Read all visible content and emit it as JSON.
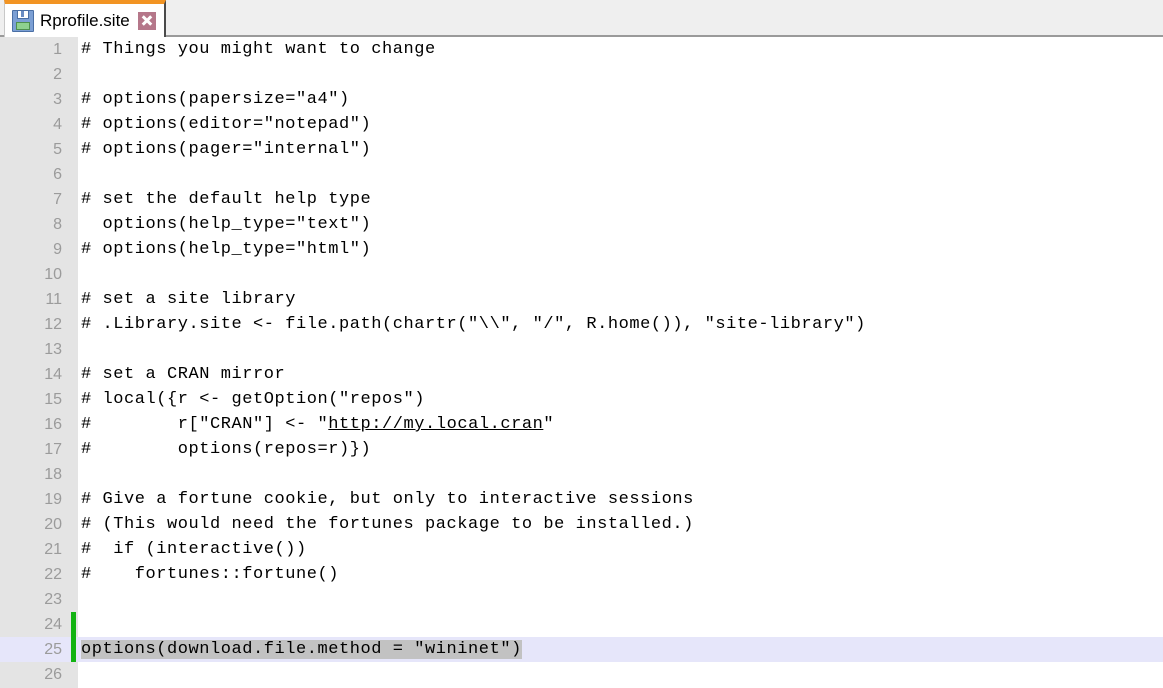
{
  "tab": {
    "title": "Rprofile.site",
    "save_icon": "floppy-disk-save-icon",
    "close_icon": "close-x-icon",
    "modified_accent_color": "#f29423"
  },
  "editor": {
    "gutter_color": "#e4e4e4",
    "line_number_color": "#9b9b9b",
    "current_line_color": "#e6e6fa",
    "selection_color": "#c2c2c2",
    "change_marker_color": "#12b312",
    "lines": [
      {
        "n": "1",
        "text": "# Things you might want to change"
      },
      {
        "n": "2",
        "text": ""
      },
      {
        "n": "3",
        "text": "# options(papersize=\"a4\")"
      },
      {
        "n": "4",
        "text": "# options(editor=\"notepad\")"
      },
      {
        "n": "5",
        "text": "# options(pager=\"internal\")"
      },
      {
        "n": "6",
        "text": ""
      },
      {
        "n": "7",
        "text": "# set the default help type"
      },
      {
        "n": "8",
        "text": "  options(help_type=\"text\")"
      },
      {
        "n": "9",
        "text": "# options(help_type=\"html\")"
      },
      {
        "n": "10",
        "text": ""
      },
      {
        "n": "11",
        "text": "# set a site library"
      },
      {
        "n": "12",
        "text": "# .Library.site <- file.path(chartr(\"\\\\\", \"/\", R.home()), \"site-library\")"
      },
      {
        "n": "13",
        "text": ""
      },
      {
        "n": "14",
        "text": "# set a CRAN mirror"
      },
      {
        "n": "15",
        "text": "# local({r <- getOption(\"repos\")"
      },
      {
        "n": "16",
        "pre": "#        r[\"CRAN\"] <- \"",
        "link": "http://my.local.cran",
        "post": "\""
      },
      {
        "n": "17",
        "text": "#        options(repos=r)})"
      },
      {
        "n": "18",
        "text": ""
      },
      {
        "n": "19",
        "text": "# Give a fortune cookie, but only to interactive sessions"
      },
      {
        "n": "20",
        "text": "# (This would need the fortunes package to be installed.)"
      },
      {
        "n": "21",
        "text": "#  if (interactive())"
      },
      {
        "n": "22",
        "text": "#    fortunes::fortune()"
      },
      {
        "n": "23",
        "text": ""
      },
      {
        "n": "24",
        "text": "",
        "changed": true
      },
      {
        "n": "25",
        "text": "options(download.file.method = \"wininet\")",
        "changed": true,
        "current": true,
        "selected": true
      },
      {
        "n": "26",
        "text": ""
      }
    ]
  }
}
